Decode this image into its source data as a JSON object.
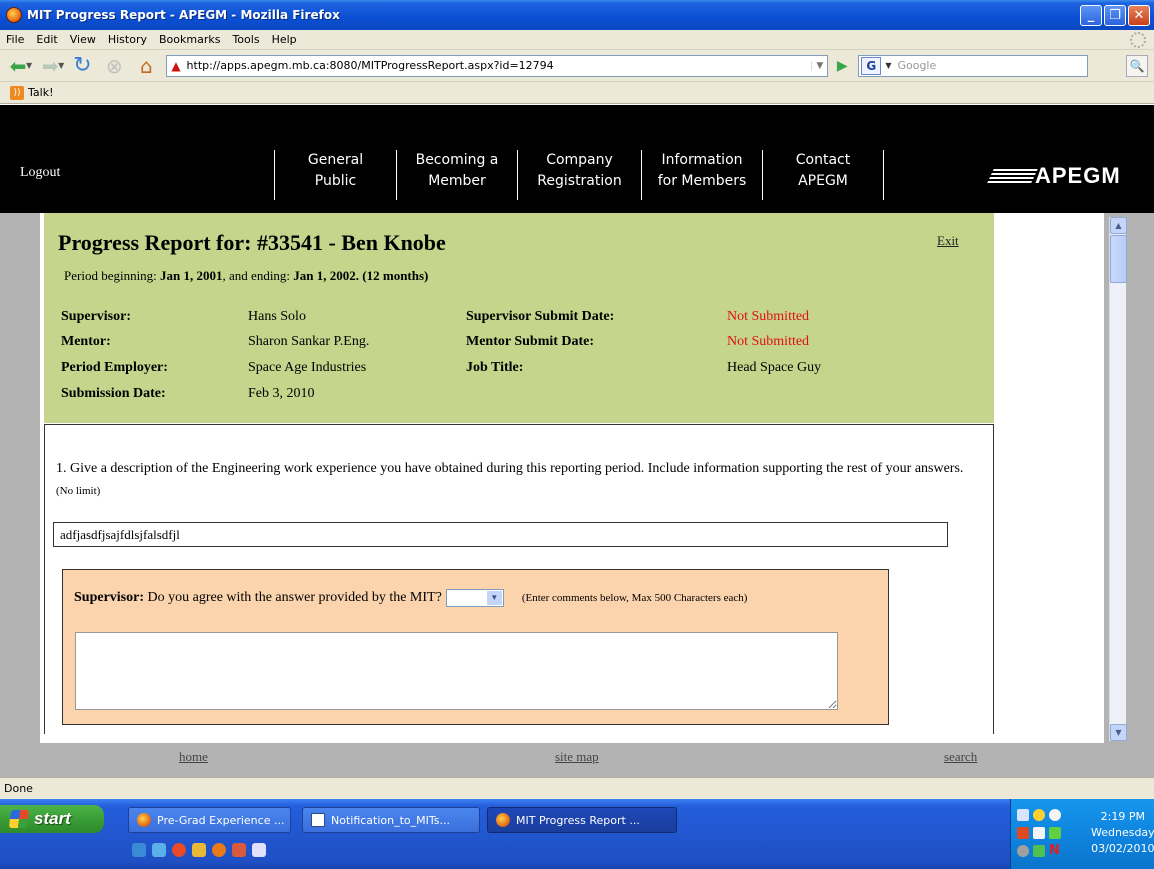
{
  "window": {
    "title": "MIT Progress Report - APEGM - Mozilla Firefox"
  },
  "menu": [
    "File",
    "Edit",
    "View",
    "History",
    "Bookmarks",
    "Tools",
    "Help"
  ],
  "navbar": {
    "url": "http://apps.apegm.mb.ca:8080/MITProgressReport.aspx?id=12794",
    "search_placeholder": "Google"
  },
  "bookmarks": {
    "items": [
      "Talk!"
    ]
  },
  "site": {
    "logout": "Logout",
    "nav": [
      {
        "line1": "General",
        "line2": "Public"
      },
      {
        "line1": "Becoming a",
        "line2": "Member"
      },
      {
        "line1": "Company",
        "line2": "Registration"
      },
      {
        "line1": "Information",
        "line2": "for Members"
      },
      {
        "line1": "Contact",
        "line2": "APEGM"
      }
    ],
    "logo": "APEGM"
  },
  "report": {
    "title": "Progress Report for: #33541 - Ben Knobe",
    "exit": "Exit",
    "period_prefix": "Period beginning:",
    "period_start": "Jan 1, 2001",
    "period_mid": ", and ending:",
    "period_end": "Jan 1, 2002.",
    "period_months": "(12 months)",
    "supervisor_label": "Supervisor:",
    "supervisor": "Hans Solo",
    "mentor_label": "Mentor:",
    "mentor": "Sharon Sankar P.Eng.",
    "employer_label": "Period Employer:",
    "employer": "Space Age Industries",
    "submission_label": "Submission Date:",
    "submission": "Feb 3, 2010",
    "sup_submit_label": "Supervisor Submit Date:",
    "sup_submit": "Not Submitted",
    "mentor_submit_label": "Mentor Submit Date:",
    "mentor_submit": "Not Submitted",
    "job_title_label": "Job Title:",
    "job_title": "Head Space Guy"
  },
  "question1": {
    "number": "1",
    "text": ". Give a description of the Engineering work experience you have obtained during this reporting period. Include information supporting the rest of your answers.",
    "limit": "(No limit)",
    "answer": "adfjasdfjsajfdlsjfalsdfjl",
    "supervisor_label": "Supervisor:",
    "supervisor_question": "Do you agree with the answer provided by the MIT?",
    "agree_value": "",
    "comment_hint": "(Enter comments below, Max 500 Characters each)"
  },
  "footer": {
    "home": "home",
    "sitemap": "site map",
    "search": "search"
  },
  "status": "Done",
  "taskbar": {
    "start": "start",
    "tasks": [
      "Pre-Grad Experience ...",
      "Notification_to_MITs...",
      "MIT Progress Report ..."
    ],
    "time": "2:19 PM",
    "day": "Wednesday",
    "date": "03/02/2010"
  }
}
